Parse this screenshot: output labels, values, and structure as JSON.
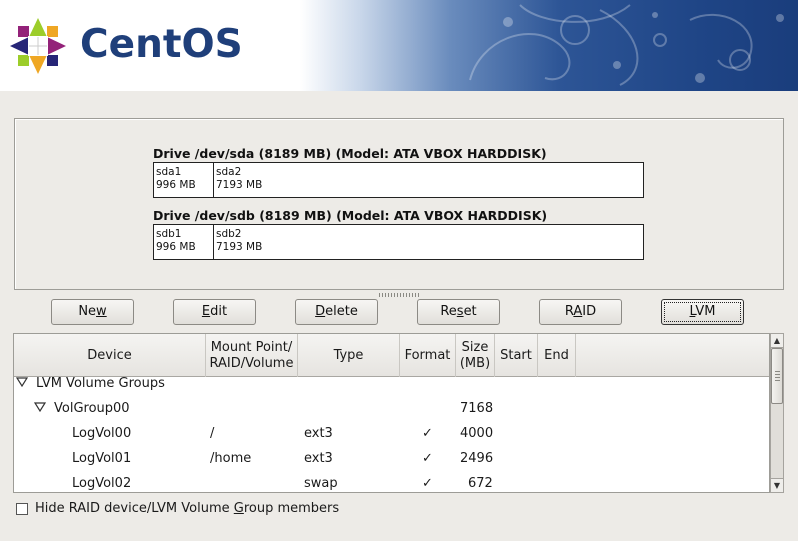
{
  "header": {
    "brand": "CentOS"
  },
  "drives": [
    {
      "title": "Drive /dev/sda (8189 MB) (Model: ATA VBOX HARDDISK)",
      "partitions": [
        {
          "name": "sda1",
          "size": "996 MB"
        },
        {
          "name": "sda2",
          "size": "7193 MB"
        }
      ]
    },
    {
      "title": "Drive /dev/sdb (8189 MB) (Model: ATA VBOX HARDDISK)",
      "partitions": [
        {
          "name": "sdb1",
          "size": "996 MB"
        },
        {
          "name": "sdb2",
          "size": "7193 MB"
        }
      ]
    }
  ],
  "buttons": {
    "new": {
      "pre": "Ne",
      "key": "w",
      "post": ""
    },
    "edit": {
      "pre": "",
      "key": "E",
      "post": "dit"
    },
    "delete": {
      "pre": "",
      "key": "D",
      "post": "elete"
    },
    "reset": {
      "pre": "Re",
      "key": "s",
      "post": "et"
    },
    "raid": {
      "pre": "R",
      "key": "A",
      "post": "ID"
    },
    "lvm": {
      "pre": "",
      "key": "L",
      "post": "VM"
    }
  },
  "table": {
    "columns": {
      "device": "Device",
      "mount_line1": "Mount Point/",
      "mount_line2": "RAID/Volume",
      "type": "Type",
      "format": "Format",
      "size_line1": "Size",
      "size_line2": "(MB)",
      "start": "Start",
      "end": "End"
    },
    "rows": [
      {
        "device": "LVM Volume Groups",
        "mount": "",
        "type": "",
        "format": false,
        "size": ""
      },
      {
        "device": "VolGroup00",
        "mount": "",
        "type": "",
        "format": false,
        "size": "7168"
      },
      {
        "device": "LogVol00",
        "mount": "/",
        "type": "ext3",
        "format": true,
        "size": "4000"
      },
      {
        "device": "LogVol01",
        "mount": "/home",
        "type": "ext3",
        "format": true,
        "size": "2496"
      },
      {
        "device": "LogVol02",
        "mount": "",
        "type": "swap",
        "format": true,
        "size": "672"
      }
    ],
    "format_mark": "✓"
  },
  "hide_members": {
    "pre": "Hide RAID device/LVM Volume ",
    "key": "G",
    "post": "roup members",
    "checked": false
  }
}
